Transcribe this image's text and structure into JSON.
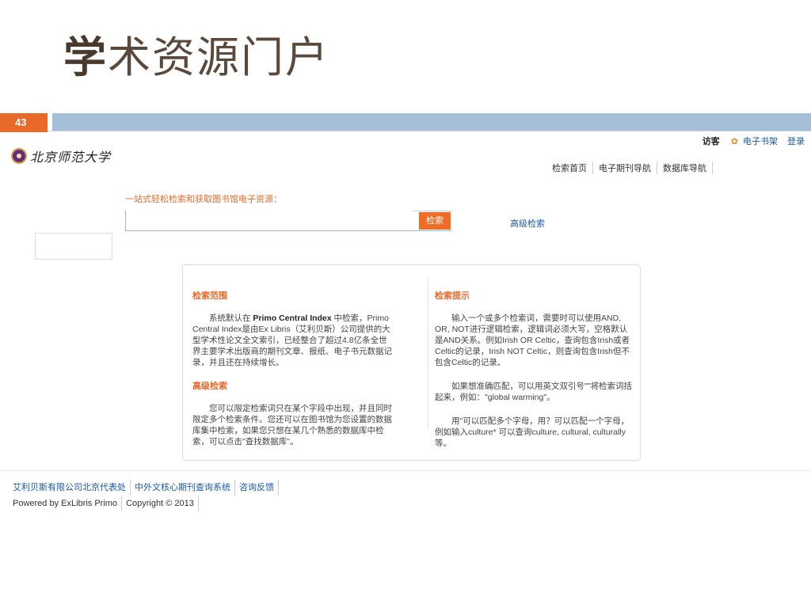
{
  "slide": {
    "title_first": "学",
    "title_rest": "术资源门户",
    "page_number": "43"
  },
  "site": {
    "top_links": {
      "visitor": "访客",
      "star_icon": "star-icon",
      "bookshelf": "电子书架",
      "login": "登录"
    },
    "logo_text": "北京师范大学",
    "nav": [
      "检索首页",
      "电子期刊导航",
      "数据库导航"
    ],
    "search": {
      "prompt": "一站式轻松检索和获取图书馆电子资源：",
      "value": "",
      "placeholder": "",
      "button": "检索",
      "advanced": "高级检索"
    },
    "help": {
      "scope_title": "检索范围",
      "scope_text_a": "系统默认在",
      "scope_text_b": "Primo Central Index",
      "scope_text_c": "中检索，Primo Central Index是由Ex Libris（艾利贝斯）公司提供的大型学术性论文全文索引，已经整合了超过4.8亿条全世界主要学术出版商的期刊文章、报纸、电子书元数据记录，并且还在持续增长。",
      "advanced_title": "高级检索",
      "advanced_text": "您可以限定检索词只在某个字段中出现，并且同时限定多个检索条件。您还可以在图书馆为您设置的数据库集中检索，如果您只想在某几个熟悉的数据库中检索，可以点击\"查找数据库\"。",
      "tips_title": "检索提示",
      "tips_text_1": "输入一个或多个检索词，需要时可以使用AND, OR, NOT进行逻辑检索，逻辑词必须大写，空格默认是AND关系。例如Irish OR Celtic，查询包含Irish或者Celtic的记录，Irish NOT Celtic，则查询包含Irish但不包含Celtic的记录。",
      "tips_text_2": "如果想准确匹配，可以用英文双引号\"\"将检索词括起来，例如：\"global warming\"。",
      "tips_text_3": "用\"可以匹配多个字母，用？可以匹配一个字母，例如输入culture* 可以查询culture, cultural, culturally等。"
    },
    "footer": {
      "links": [
        "艾利贝斯有限公司北京代表处",
        "中外文核心期刊查询系统",
        "咨询反馈"
      ],
      "meta": [
        "Powered by ExLibris Primo",
        "Copyright © 2013"
      ]
    }
  }
}
